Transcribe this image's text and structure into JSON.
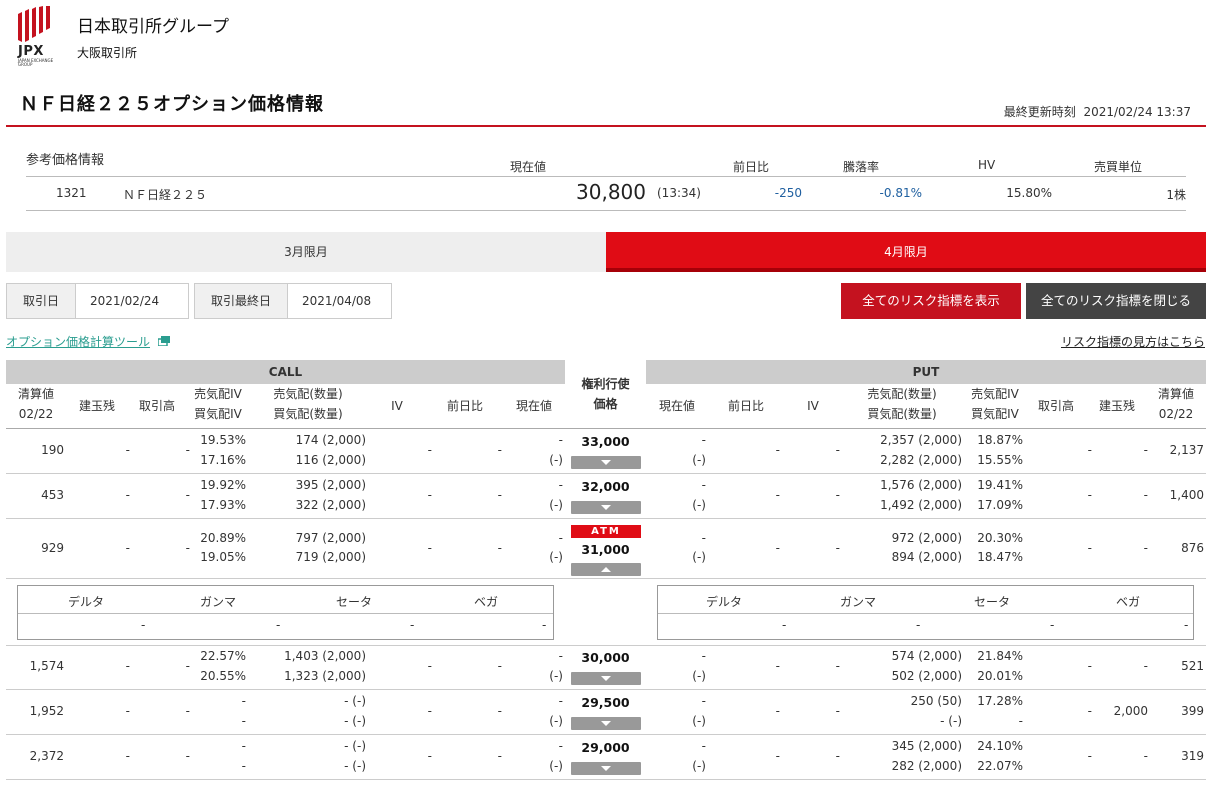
{
  "header": {
    "logo_text": "JPX",
    "logo_sub": "JAPAN EXCHANGE GROUP",
    "group_name": "日本取引所グループ",
    "exchange_name": "大阪取引所",
    "page_title": "ＮＦ日経２２５オプション価格情報",
    "last_updated_label": "最終更新時刻",
    "last_updated": "2021/02/24 13:37",
    "accent_color": "#c4121f"
  },
  "reference": {
    "title": "参考価格情報",
    "headers": {
      "price": "現在値",
      "change": "前日比",
      "rate": "騰落率",
      "hv": "HV",
      "unit": "売買単位"
    },
    "code": "1321",
    "name": "ＮＦ日経２２５",
    "price": "30,800",
    "time": "(13:34)",
    "change": "-250",
    "rate": "-0.81%",
    "hv": "15.80%",
    "unit": "1株"
  },
  "tabs": [
    {
      "label": "3月限月",
      "active": false
    },
    {
      "label": "4月限月",
      "active": true
    }
  ],
  "dates": {
    "trade_label": "取引日",
    "trade_date": "2021/02/24",
    "last_label": "取引最終日",
    "last_date": "2021/04/08"
  },
  "buttons": {
    "show_risk": "全てのリスク指標を表示",
    "close_risk": "全てのリスク指標を閉じる"
  },
  "links": {
    "calc_tool": "オプション価格計算ツール",
    "risk_help": "リスク指標の見方はこちら"
  },
  "table": {
    "call_label": "CALL",
    "put_label": "PUT",
    "strike_label_1": "権利行使",
    "strike_label_2": "価格",
    "call_headers": {
      "settle_1": "清算値",
      "settle_2": "02/22",
      "oi": "建玉残",
      "volume": "取引高",
      "ask_iv": "売気配IV",
      "bid_iv": "買気配IV",
      "ask_qty": "売気配(数量)",
      "bid_qty": "買気配(数量)",
      "iv": "IV",
      "change": "前日比",
      "price": "現在値"
    },
    "put_headers": {
      "price": "現在値",
      "change": "前日比",
      "iv": "IV",
      "ask_qty": "売気配(数量)",
      "bid_qty": "買気配(数量)",
      "ask_iv": "売気配IV",
      "bid_iv": "買気配IV",
      "volume": "取引高",
      "oi": "建玉残",
      "settle_1": "清算値",
      "settle_2": "02/22"
    },
    "atm_label": "ATM",
    "rows": [
      {
        "strike": "33,000",
        "call": {
          "settle": "190",
          "oi": "-",
          "vol": "-",
          "ask_iv": "19.53%",
          "bid_iv": "17.16%",
          "ask_q": "174 (2,000)",
          "bid_q": "116 (2,000)",
          "iv": "-",
          "chg": "-",
          "px": "-",
          "px2": "(-)"
        },
        "put": {
          "px": "-",
          "px2": "(-)",
          "chg": "-",
          "iv": "-",
          "ask_q": "2,357 (2,000)",
          "bid_q": "2,282 (2,000)",
          "ask_iv": "18.87%",
          "bid_iv": "15.55%",
          "vol": "-",
          "oi": "-",
          "settle": "2,137"
        }
      },
      {
        "strike": "32,000",
        "call": {
          "settle": "453",
          "oi": "-",
          "vol": "-",
          "ask_iv": "19.92%",
          "bid_iv": "17.93%",
          "ask_q": "395 (2,000)",
          "bid_q": "322 (2,000)",
          "iv": "-",
          "chg": "-",
          "px": "-",
          "px2": "(-)"
        },
        "put": {
          "px": "-",
          "px2": "(-)",
          "chg": "-",
          "iv": "-",
          "ask_q": "1,576 (2,000)",
          "bid_q": "1,492 (2,000)",
          "ask_iv": "19.41%",
          "bid_iv": "17.09%",
          "vol": "-",
          "oi": "-",
          "settle": "1,400"
        }
      },
      {
        "strike": "31,000",
        "call": {
          "settle": "929",
          "oi": "-",
          "vol": "-",
          "ask_iv": "20.89%",
          "bid_iv": "19.05%",
          "ask_q": "797 (2,000)",
          "bid_q": "719 (2,000)",
          "iv": "-",
          "chg": "-",
          "px": "-",
          "px2": "(-)"
        },
        "put": {
          "px": "-",
          "px2": "(-)",
          "chg": "-",
          "iv": "-",
          "ask_q": "972 (2,000)",
          "bid_q": "894 (2,000)",
          "ask_iv": "20.30%",
          "bid_iv": "18.47%",
          "vol": "-",
          "oi": "-",
          "settle": "876"
        }
      },
      {
        "strike": "30,000",
        "call": {
          "settle": "1,574",
          "oi": "-",
          "vol": "-",
          "ask_iv": "22.57%",
          "bid_iv": "20.55%",
          "ask_q": "1,403 (2,000)",
          "bid_q": "1,323 (2,000)",
          "iv": "-",
          "chg": "-",
          "px": "-",
          "px2": "(-)"
        },
        "put": {
          "px": "-",
          "px2": "(-)",
          "chg": "-",
          "iv": "-",
          "ask_q": "574 (2,000)",
          "bid_q": "502 (2,000)",
          "ask_iv": "21.84%",
          "bid_iv": "20.01%",
          "vol": "-",
          "oi": "-",
          "settle": "521"
        }
      },
      {
        "strike": "29,500",
        "call": {
          "settle": "1,952",
          "oi": "-",
          "vol": "-",
          "ask_iv": "-",
          "bid_iv": "-",
          "ask_q": "- (-)",
          "bid_q": "- (-)",
          "iv": "-",
          "chg": "-",
          "px": "-",
          "px2": "(-)"
        },
        "put": {
          "px": "-",
          "px2": "(-)",
          "chg": "-",
          "iv": "-",
          "ask_q": "250 (50)",
          "bid_q": "- (-)",
          "ask_iv": "17.28%",
          "bid_iv": "-",
          "vol": "-",
          "oi": "2,000",
          "settle": "399"
        }
      },
      {
        "strike": "29,000",
        "call": {
          "settle": "2,372",
          "oi": "-",
          "vol": "-",
          "ask_iv": "-",
          "bid_iv": "-",
          "ask_q": "- (-)",
          "bid_q": "- (-)",
          "iv": "-",
          "chg": "-",
          "px": "-",
          "px2": "(-)"
        },
        "put": {
          "px": "-",
          "px2": "(-)",
          "chg": "-",
          "iv": "-",
          "ask_q": "345 (2,000)",
          "bid_q": "282 (2,000)",
          "ask_iv": "24.10%",
          "bid_iv": "22.07%",
          "vol": "-",
          "oi": "-",
          "settle": "319"
        }
      }
    ]
  },
  "risk": {
    "headers": {
      "delta": "デルタ",
      "gamma": "ガンマ",
      "theta": "セータ",
      "vega": "ベガ"
    },
    "call": {
      "delta": "-",
      "gamma": "-",
      "theta": "-",
      "vega": "-"
    },
    "put": {
      "delta": "-",
      "gamma": "-",
      "theta": "-",
      "vega": "-"
    }
  }
}
